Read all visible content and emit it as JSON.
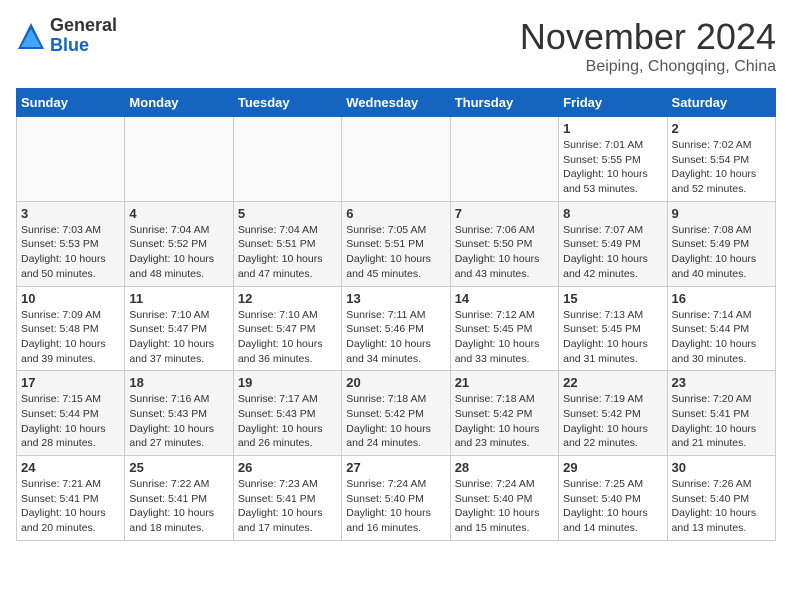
{
  "header": {
    "logo_general": "General",
    "logo_blue": "Blue",
    "month_title": "November 2024",
    "location": "Beiping, Chongqing, China"
  },
  "weekdays": [
    "Sunday",
    "Monday",
    "Tuesday",
    "Wednesday",
    "Thursday",
    "Friday",
    "Saturday"
  ],
  "weeks": [
    [
      {
        "day": "",
        "text": ""
      },
      {
        "day": "",
        "text": ""
      },
      {
        "day": "",
        "text": ""
      },
      {
        "day": "",
        "text": ""
      },
      {
        "day": "",
        "text": ""
      },
      {
        "day": "1",
        "text": "Sunrise: 7:01 AM\nSunset: 5:55 PM\nDaylight: 10 hours and 53 minutes."
      },
      {
        "day": "2",
        "text": "Sunrise: 7:02 AM\nSunset: 5:54 PM\nDaylight: 10 hours and 52 minutes."
      }
    ],
    [
      {
        "day": "3",
        "text": "Sunrise: 7:03 AM\nSunset: 5:53 PM\nDaylight: 10 hours and 50 minutes."
      },
      {
        "day": "4",
        "text": "Sunrise: 7:04 AM\nSunset: 5:52 PM\nDaylight: 10 hours and 48 minutes."
      },
      {
        "day": "5",
        "text": "Sunrise: 7:04 AM\nSunset: 5:51 PM\nDaylight: 10 hours and 47 minutes."
      },
      {
        "day": "6",
        "text": "Sunrise: 7:05 AM\nSunset: 5:51 PM\nDaylight: 10 hours and 45 minutes."
      },
      {
        "day": "7",
        "text": "Sunrise: 7:06 AM\nSunset: 5:50 PM\nDaylight: 10 hours and 43 minutes."
      },
      {
        "day": "8",
        "text": "Sunrise: 7:07 AM\nSunset: 5:49 PM\nDaylight: 10 hours and 42 minutes."
      },
      {
        "day": "9",
        "text": "Sunrise: 7:08 AM\nSunset: 5:49 PM\nDaylight: 10 hours and 40 minutes."
      }
    ],
    [
      {
        "day": "10",
        "text": "Sunrise: 7:09 AM\nSunset: 5:48 PM\nDaylight: 10 hours and 39 minutes."
      },
      {
        "day": "11",
        "text": "Sunrise: 7:10 AM\nSunset: 5:47 PM\nDaylight: 10 hours and 37 minutes."
      },
      {
        "day": "12",
        "text": "Sunrise: 7:10 AM\nSunset: 5:47 PM\nDaylight: 10 hours and 36 minutes."
      },
      {
        "day": "13",
        "text": "Sunrise: 7:11 AM\nSunset: 5:46 PM\nDaylight: 10 hours and 34 minutes."
      },
      {
        "day": "14",
        "text": "Sunrise: 7:12 AM\nSunset: 5:45 PM\nDaylight: 10 hours and 33 minutes."
      },
      {
        "day": "15",
        "text": "Sunrise: 7:13 AM\nSunset: 5:45 PM\nDaylight: 10 hours and 31 minutes."
      },
      {
        "day": "16",
        "text": "Sunrise: 7:14 AM\nSunset: 5:44 PM\nDaylight: 10 hours and 30 minutes."
      }
    ],
    [
      {
        "day": "17",
        "text": "Sunrise: 7:15 AM\nSunset: 5:44 PM\nDaylight: 10 hours and 28 minutes."
      },
      {
        "day": "18",
        "text": "Sunrise: 7:16 AM\nSunset: 5:43 PM\nDaylight: 10 hours and 27 minutes."
      },
      {
        "day": "19",
        "text": "Sunrise: 7:17 AM\nSunset: 5:43 PM\nDaylight: 10 hours and 26 minutes."
      },
      {
        "day": "20",
        "text": "Sunrise: 7:18 AM\nSunset: 5:42 PM\nDaylight: 10 hours and 24 minutes."
      },
      {
        "day": "21",
        "text": "Sunrise: 7:18 AM\nSunset: 5:42 PM\nDaylight: 10 hours and 23 minutes."
      },
      {
        "day": "22",
        "text": "Sunrise: 7:19 AM\nSunset: 5:42 PM\nDaylight: 10 hours and 22 minutes."
      },
      {
        "day": "23",
        "text": "Sunrise: 7:20 AM\nSunset: 5:41 PM\nDaylight: 10 hours and 21 minutes."
      }
    ],
    [
      {
        "day": "24",
        "text": "Sunrise: 7:21 AM\nSunset: 5:41 PM\nDaylight: 10 hours and 20 minutes."
      },
      {
        "day": "25",
        "text": "Sunrise: 7:22 AM\nSunset: 5:41 PM\nDaylight: 10 hours and 18 minutes."
      },
      {
        "day": "26",
        "text": "Sunrise: 7:23 AM\nSunset: 5:41 PM\nDaylight: 10 hours and 17 minutes."
      },
      {
        "day": "27",
        "text": "Sunrise: 7:24 AM\nSunset: 5:40 PM\nDaylight: 10 hours and 16 minutes."
      },
      {
        "day": "28",
        "text": "Sunrise: 7:24 AM\nSunset: 5:40 PM\nDaylight: 10 hours and 15 minutes."
      },
      {
        "day": "29",
        "text": "Sunrise: 7:25 AM\nSunset: 5:40 PM\nDaylight: 10 hours and 14 minutes."
      },
      {
        "day": "30",
        "text": "Sunrise: 7:26 AM\nSunset: 5:40 PM\nDaylight: 10 hours and 13 minutes."
      }
    ]
  ]
}
